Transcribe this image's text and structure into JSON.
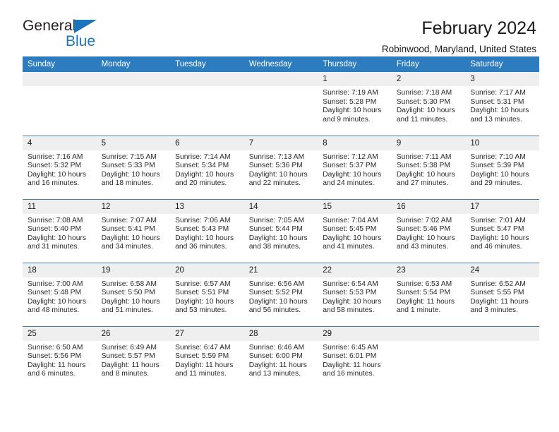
{
  "brand": {
    "name_top": "General",
    "name_bottom": "Blue",
    "triangle_color": "#1b75bb"
  },
  "header": {
    "title": "February 2024",
    "subtitle": "Robinwood, Maryland, United States",
    "header_bg": "#2e7cc0",
    "daynum_bg": "#efefef"
  },
  "weekday_headers": [
    "Sunday",
    "Monday",
    "Tuesday",
    "Wednesday",
    "Thursday",
    "Friday",
    "Saturday"
  ],
  "labels": {
    "sunrise": "Sunrise:",
    "sunset": "Sunset:",
    "daylight": "Daylight:"
  },
  "weeks": [
    [
      {
        "day": "",
        "sunrise": "",
        "sunset": "",
        "daylight_line1": "",
        "daylight_line2": ""
      },
      {
        "day": "",
        "sunrise": "",
        "sunset": "",
        "daylight_line1": "",
        "daylight_line2": ""
      },
      {
        "day": "",
        "sunrise": "",
        "sunset": "",
        "daylight_line1": "",
        "daylight_line2": ""
      },
      {
        "day": "",
        "sunrise": "",
        "sunset": "",
        "daylight_line1": "",
        "daylight_line2": ""
      },
      {
        "day": "1",
        "sunrise": "Sunrise: 7:19 AM",
        "sunset": "Sunset: 5:28 PM",
        "daylight_line1": "Daylight: 10 hours",
        "daylight_line2": "and 9 minutes."
      },
      {
        "day": "2",
        "sunrise": "Sunrise: 7:18 AM",
        "sunset": "Sunset: 5:30 PM",
        "daylight_line1": "Daylight: 10 hours",
        "daylight_line2": "and 11 minutes."
      },
      {
        "day": "3",
        "sunrise": "Sunrise: 7:17 AM",
        "sunset": "Sunset: 5:31 PM",
        "daylight_line1": "Daylight: 10 hours",
        "daylight_line2": "and 13 minutes."
      }
    ],
    [
      {
        "day": "4",
        "sunrise": "Sunrise: 7:16 AM",
        "sunset": "Sunset: 5:32 PM",
        "daylight_line1": "Daylight: 10 hours",
        "daylight_line2": "and 16 minutes."
      },
      {
        "day": "5",
        "sunrise": "Sunrise: 7:15 AM",
        "sunset": "Sunset: 5:33 PM",
        "daylight_line1": "Daylight: 10 hours",
        "daylight_line2": "and 18 minutes."
      },
      {
        "day": "6",
        "sunrise": "Sunrise: 7:14 AM",
        "sunset": "Sunset: 5:34 PM",
        "daylight_line1": "Daylight: 10 hours",
        "daylight_line2": "and 20 minutes."
      },
      {
        "day": "7",
        "sunrise": "Sunrise: 7:13 AM",
        "sunset": "Sunset: 5:36 PM",
        "daylight_line1": "Daylight: 10 hours",
        "daylight_line2": "and 22 minutes."
      },
      {
        "day": "8",
        "sunrise": "Sunrise: 7:12 AM",
        "sunset": "Sunset: 5:37 PM",
        "daylight_line1": "Daylight: 10 hours",
        "daylight_line2": "and 24 minutes."
      },
      {
        "day": "9",
        "sunrise": "Sunrise: 7:11 AM",
        "sunset": "Sunset: 5:38 PM",
        "daylight_line1": "Daylight: 10 hours",
        "daylight_line2": "and 27 minutes."
      },
      {
        "day": "10",
        "sunrise": "Sunrise: 7:10 AM",
        "sunset": "Sunset: 5:39 PM",
        "daylight_line1": "Daylight: 10 hours",
        "daylight_line2": "and 29 minutes."
      }
    ],
    [
      {
        "day": "11",
        "sunrise": "Sunrise: 7:08 AM",
        "sunset": "Sunset: 5:40 PM",
        "daylight_line1": "Daylight: 10 hours",
        "daylight_line2": "and 31 minutes."
      },
      {
        "day": "12",
        "sunrise": "Sunrise: 7:07 AM",
        "sunset": "Sunset: 5:41 PM",
        "daylight_line1": "Daylight: 10 hours",
        "daylight_line2": "and 34 minutes."
      },
      {
        "day": "13",
        "sunrise": "Sunrise: 7:06 AM",
        "sunset": "Sunset: 5:43 PM",
        "daylight_line1": "Daylight: 10 hours",
        "daylight_line2": "and 36 minutes."
      },
      {
        "day": "14",
        "sunrise": "Sunrise: 7:05 AM",
        "sunset": "Sunset: 5:44 PM",
        "daylight_line1": "Daylight: 10 hours",
        "daylight_line2": "and 38 minutes."
      },
      {
        "day": "15",
        "sunrise": "Sunrise: 7:04 AM",
        "sunset": "Sunset: 5:45 PM",
        "daylight_line1": "Daylight: 10 hours",
        "daylight_line2": "and 41 minutes."
      },
      {
        "day": "16",
        "sunrise": "Sunrise: 7:02 AM",
        "sunset": "Sunset: 5:46 PM",
        "daylight_line1": "Daylight: 10 hours",
        "daylight_line2": "and 43 minutes."
      },
      {
        "day": "17",
        "sunrise": "Sunrise: 7:01 AM",
        "sunset": "Sunset: 5:47 PM",
        "daylight_line1": "Daylight: 10 hours",
        "daylight_line2": "and 46 minutes."
      }
    ],
    [
      {
        "day": "18",
        "sunrise": "Sunrise: 7:00 AM",
        "sunset": "Sunset: 5:48 PM",
        "daylight_line1": "Daylight: 10 hours",
        "daylight_line2": "and 48 minutes."
      },
      {
        "day": "19",
        "sunrise": "Sunrise: 6:58 AM",
        "sunset": "Sunset: 5:50 PM",
        "daylight_line1": "Daylight: 10 hours",
        "daylight_line2": "and 51 minutes."
      },
      {
        "day": "20",
        "sunrise": "Sunrise: 6:57 AM",
        "sunset": "Sunset: 5:51 PM",
        "daylight_line1": "Daylight: 10 hours",
        "daylight_line2": "and 53 minutes."
      },
      {
        "day": "21",
        "sunrise": "Sunrise: 6:56 AM",
        "sunset": "Sunset: 5:52 PM",
        "daylight_line1": "Daylight: 10 hours",
        "daylight_line2": "and 56 minutes."
      },
      {
        "day": "22",
        "sunrise": "Sunrise: 6:54 AM",
        "sunset": "Sunset: 5:53 PM",
        "daylight_line1": "Daylight: 10 hours",
        "daylight_line2": "and 58 minutes."
      },
      {
        "day": "23",
        "sunrise": "Sunrise: 6:53 AM",
        "sunset": "Sunset: 5:54 PM",
        "daylight_line1": "Daylight: 11 hours",
        "daylight_line2": "and 1 minute."
      },
      {
        "day": "24",
        "sunrise": "Sunrise: 6:52 AM",
        "sunset": "Sunset: 5:55 PM",
        "daylight_line1": "Daylight: 11 hours",
        "daylight_line2": "and 3 minutes."
      }
    ],
    [
      {
        "day": "25",
        "sunrise": "Sunrise: 6:50 AM",
        "sunset": "Sunset: 5:56 PM",
        "daylight_line1": "Daylight: 11 hours",
        "daylight_line2": "and 6 minutes."
      },
      {
        "day": "26",
        "sunrise": "Sunrise: 6:49 AM",
        "sunset": "Sunset: 5:57 PM",
        "daylight_line1": "Daylight: 11 hours",
        "daylight_line2": "and 8 minutes."
      },
      {
        "day": "27",
        "sunrise": "Sunrise: 6:47 AM",
        "sunset": "Sunset: 5:59 PM",
        "daylight_line1": "Daylight: 11 hours",
        "daylight_line2": "and 11 minutes."
      },
      {
        "day": "28",
        "sunrise": "Sunrise: 6:46 AM",
        "sunset": "Sunset: 6:00 PM",
        "daylight_line1": "Daylight: 11 hours",
        "daylight_line2": "and 13 minutes."
      },
      {
        "day": "29",
        "sunrise": "Sunrise: 6:45 AM",
        "sunset": "Sunset: 6:01 PM",
        "daylight_line1": "Daylight: 11 hours",
        "daylight_line2": "and 16 minutes."
      },
      {
        "day": "",
        "sunrise": "",
        "sunset": "",
        "daylight_line1": "",
        "daylight_line2": ""
      },
      {
        "day": "",
        "sunrise": "",
        "sunset": "",
        "daylight_line1": "",
        "daylight_line2": ""
      }
    ]
  ]
}
